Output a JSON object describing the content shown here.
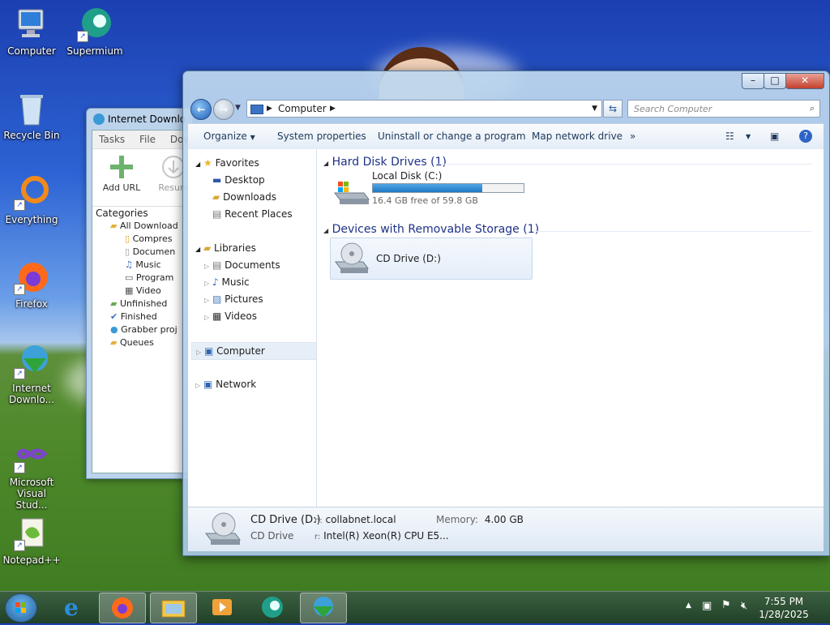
{
  "desktop": {
    "icons": [
      {
        "label": "Computer"
      },
      {
        "label": "Supermium"
      },
      {
        "label": "Recycle Bin"
      },
      {
        "label": "Everything"
      },
      {
        "label": "Firefox"
      },
      {
        "label": "Internet Downlo..."
      },
      {
        "label": "Microsoft Visual Stud..."
      },
      {
        "label": "Notepad++"
      }
    ]
  },
  "idm": {
    "title": "Internet Downlo",
    "menu": [
      "Tasks",
      "File",
      "Dow"
    ],
    "add_url": "Add URL",
    "resume": "Resum",
    "categories_title": "Categories",
    "categories": [
      "All Download",
      "Compres",
      "Documen",
      "Music",
      "Program",
      "Video",
      "Unfinished",
      "Finished",
      "Grabber proj",
      "Queues"
    ]
  },
  "explorer": {
    "breadcrumb": "Computer",
    "search_placeholder": "Search Computer",
    "commands": {
      "organize": "Organize",
      "system_properties": "System properties",
      "uninstall": "Uninstall or change a program",
      "map_drive": "Map network drive",
      "more": "»"
    },
    "nav": {
      "favorites": "Favorites",
      "desktop": "Desktop",
      "downloads": "Downloads",
      "recent": "Recent Places",
      "libraries": "Libraries",
      "documents": "Documents",
      "music": "Music",
      "pictures": "Pictures",
      "videos": "Videos",
      "computer": "Computer",
      "network": "Network"
    },
    "groups": {
      "hdd": "Hard Disk Drives (1)",
      "removable": "Devices with Removable Storage (1)"
    },
    "local_disk": {
      "name": "Local Disk (C:)",
      "free": "16.4 GB free of 59.8 GB",
      "used_fraction": 0.726
    },
    "cd_drive": {
      "name": "CD Drive (D:)"
    },
    "details": {
      "name": "CD Drive (D:)",
      "type": "CD Drive",
      "workgroup_label": "n:",
      "workgroup": "collabnet.local",
      "memory_label": "Memory:",
      "memory": "4.00 GB",
      "cpu_label": "r:",
      "cpu": "Intel(R) Xeon(R) CPU E5..."
    }
  },
  "taskbar": {
    "time": "7:55 PM",
    "date": "1/28/2025"
  },
  "colors": {
    "accent": "#1e3287",
    "progress": "#2a8ad4"
  }
}
